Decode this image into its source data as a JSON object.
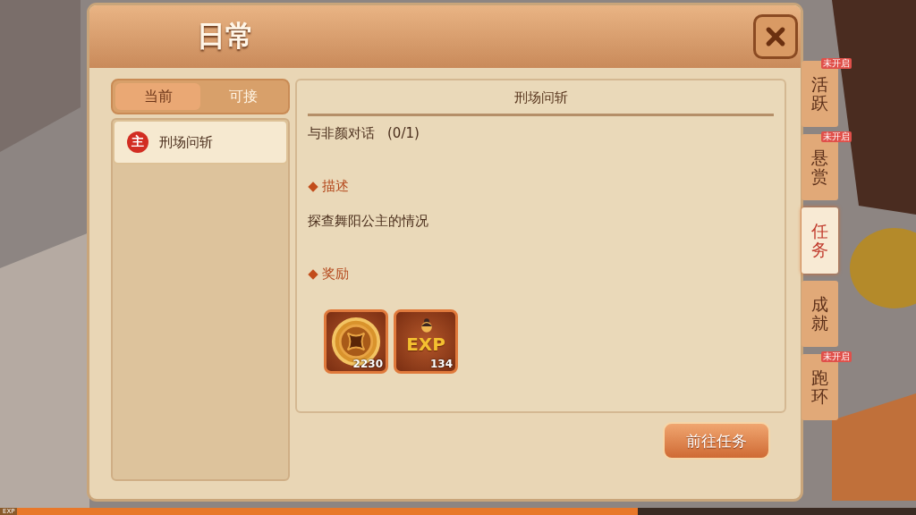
{
  "window": {
    "title": "日常"
  },
  "list_tabs": [
    {
      "label": "当前",
      "selected": true
    },
    {
      "label": "可接",
      "selected": false
    }
  ],
  "quests": [
    {
      "badge": "主",
      "name": "刑场问斩",
      "selected": true
    }
  ],
  "detail": {
    "title": "刑场问斩",
    "objective": "与非颜对话",
    "progress": "(0/1)",
    "sections": [
      {
        "heading": "描述",
        "text": "探查舞阳公主的情况"
      },
      {
        "heading": "奖励"
      }
    ],
    "rewards": [
      {
        "kind": "coin",
        "amount": "2230"
      },
      {
        "kind": "exp",
        "label": "EXP",
        "amount": "134"
      }
    ]
  },
  "go_button": "前往任务",
  "side_tabs": [
    {
      "label": "活跃",
      "selected": false,
      "badge": "未开启"
    },
    {
      "label": "悬赏",
      "selected": false,
      "badge": "未开启"
    },
    {
      "label": "任务",
      "selected": true
    },
    {
      "label": "成就",
      "selected": false
    },
    {
      "label": "跑环",
      "selected": false,
      "badge": "未开启"
    }
  ],
  "exp_bar": {
    "label": "EXP",
    "level": 0.69
  }
}
